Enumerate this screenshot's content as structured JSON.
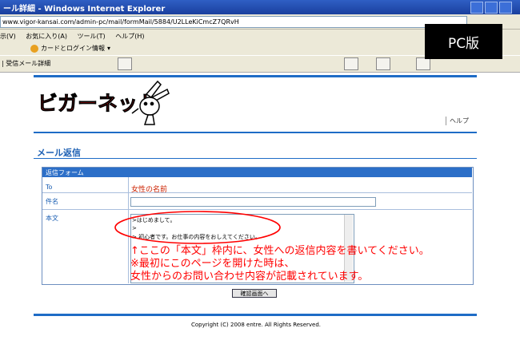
{
  "browser": {
    "title": "ール詳細 - Windows Internet Explorer",
    "address": "www.vigor-kansai.com/admin-pc/mail/formMail/5884/U2LLeKiCmcZ7QRvH",
    "menu": [
      "示(V)",
      "お気に入り(A)",
      "ツール(T)",
      "ヘルプ(H)"
    ],
    "favorite": "カードとログイン情報",
    "tab": "| 受信メール詳細"
  },
  "badge": "PC版",
  "site": {
    "logo_text": "ビガーネット",
    "help": "ヘルプ"
  },
  "page": {
    "title": "メール返信",
    "form_header": "返信フォーム",
    "to_label": "To",
    "to_value": "女性の名前",
    "subject_label": "件名",
    "subject_value": "",
    "body_label": "本文",
    "body_lines": [
      ">はじめまして。",
      ">",
      "> 初心者です。お仕事の内容をおしえてください。"
    ],
    "confirm_button": "確認画面へ",
    "copyright": "Copyright (C) 2008 entre. All Rights Reserved."
  },
  "annotation": {
    "line1": "↑ここの「本文」枠内に、女性への返信内容を書いてください。",
    "line2": "※最初にこのページを開けた時は、",
    "line3": "女性からのお問い合わせ内容が記載されています。"
  },
  "colors": {
    "accent": "#1e6cc6",
    "annotation": "#ff0000"
  }
}
